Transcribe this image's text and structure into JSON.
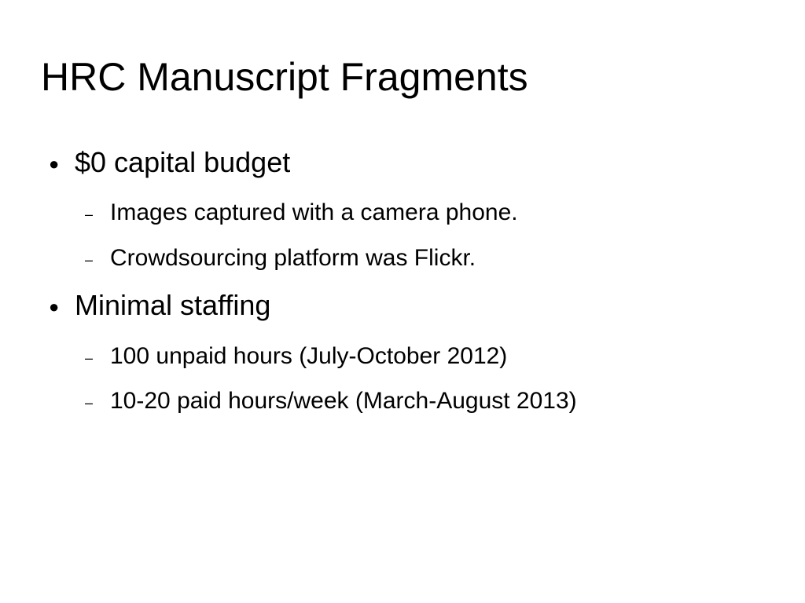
{
  "slide": {
    "title": "HRC Manuscript Fragments",
    "bullets": [
      {
        "marker": "●",
        "text": "$0 capital budget",
        "subitems": [
          {
            "marker": "–",
            "text": "Images captured with a camera phone."
          },
          {
            "marker": "–",
            "text": "Crowdsourcing platform was Flickr."
          }
        ]
      },
      {
        "marker": "●",
        "text": "Minimal staffing",
        "subitems": [
          {
            "marker": "–",
            "text": "100 unpaid hours (July-October 2012)"
          },
          {
            "marker": "–",
            "text": "10-20 paid hours/week (March-August 2013)"
          }
        ]
      }
    ]
  }
}
